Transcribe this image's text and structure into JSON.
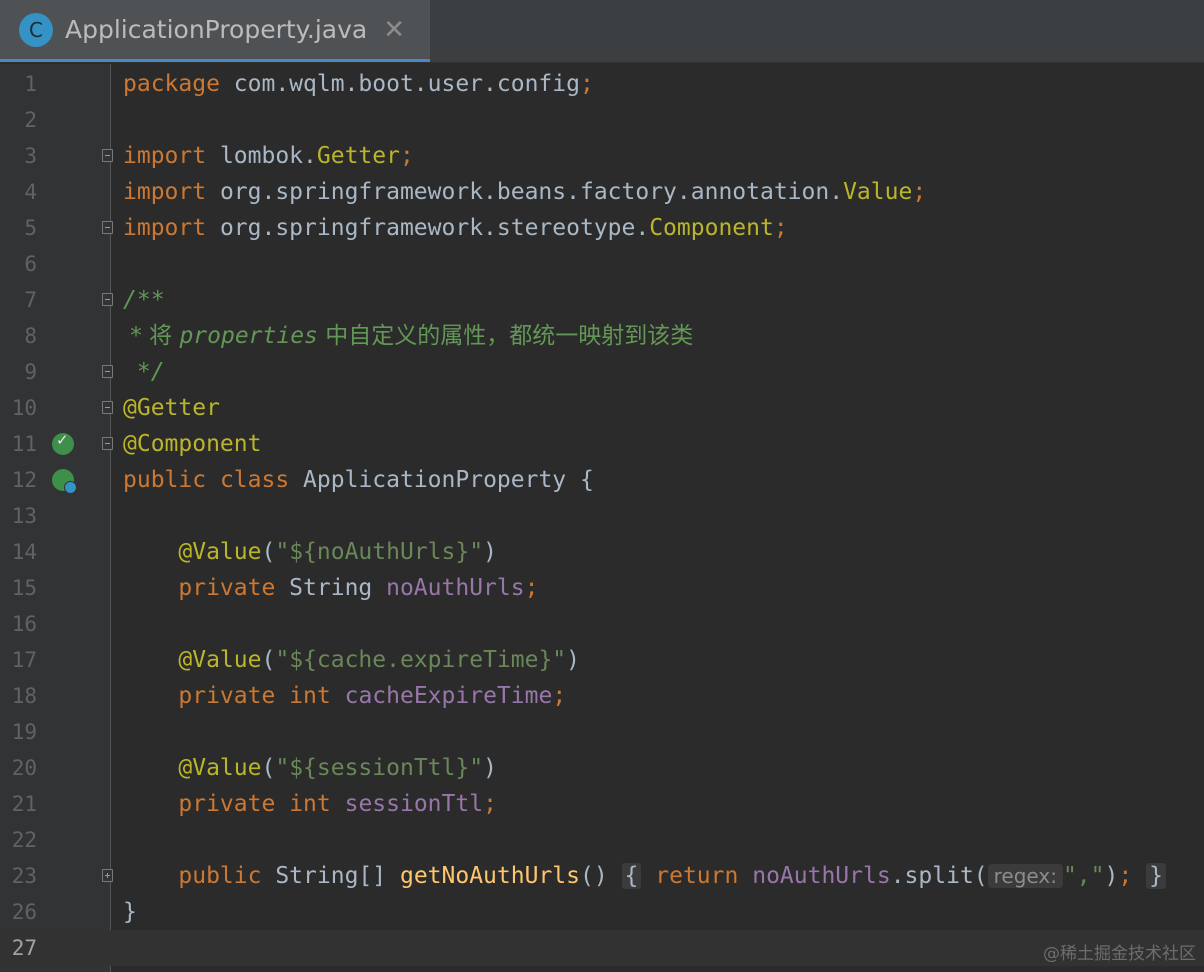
{
  "tab": {
    "icon_letter": "C",
    "title": "ApplicationProperty.java",
    "close_glyph": "✕"
  },
  "line_numbers": [
    "1",
    "2",
    "3",
    "4",
    "5",
    "6",
    "7",
    "8",
    "9",
    "10",
    "11",
    "12",
    "13",
    "14",
    "15",
    "16",
    "17",
    "18",
    "19",
    "20",
    "21",
    "22",
    "23",
    "26",
    "27"
  ],
  "code": {
    "l1_kw": "package",
    "l1_rest": " com.wqlm.boot.user.config",
    "semi": ";",
    "import_kw": "import",
    "l3_pkg": " lombok.",
    "l3_cls": "Getter",
    "l4_pkg": " org.springframework.beans.factory.annotation.",
    "l4_cls": "Value",
    "l5_pkg": " org.springframework.stereotype.",
    "l5_cls": "Component",
    "l7": "/**",
    "l8_star": " * 将 ",
    "l8_prop": "properties",
    "l8_cn": " 中自定义的属性，都统一映射到该类",
    "l9": " */",
    "l10": "@Getter",
    "l11": "@Component",
    "l12_public": "public",
    "l12_class": "class",
    "l12_name": " ApplicationProperty {",
    "value_ann": "@Value",
    "paren_open": "(",
    "paren_close": ")",
    "l14_str": "\"${noAuthUrls}\"",
    "private_kw": "private",
    "l15_type": " String ",
    "l15_field": "noAuthUrls",
    "l17_str": "\"${cache.expireTime}\"",
    "int_kw": "int",
    "l18_field": "cacheExpireTime",
    "l20_str": "\"${sessionTtl}\"",
    "l21_field": "sessionTtl",
    "l23_public": "public",
    "l23_type": " String[] ",
    "l23_method": "getNoAuthUrls",
    "l23_parens": "()",
    "l23_brace_open": "{",
    "l23_return": "return",
    "l23_field": "noAuthUrls",
    "l23_split": ".split(",
    "l23_hint": "regex:",
    "l23_arg": "\",\"",
    "l23_close": ")",
    "l23_brace_close": "}",
    "l26": "}"
  },
  "watermark": "@稀土掘金技术社区"
}
